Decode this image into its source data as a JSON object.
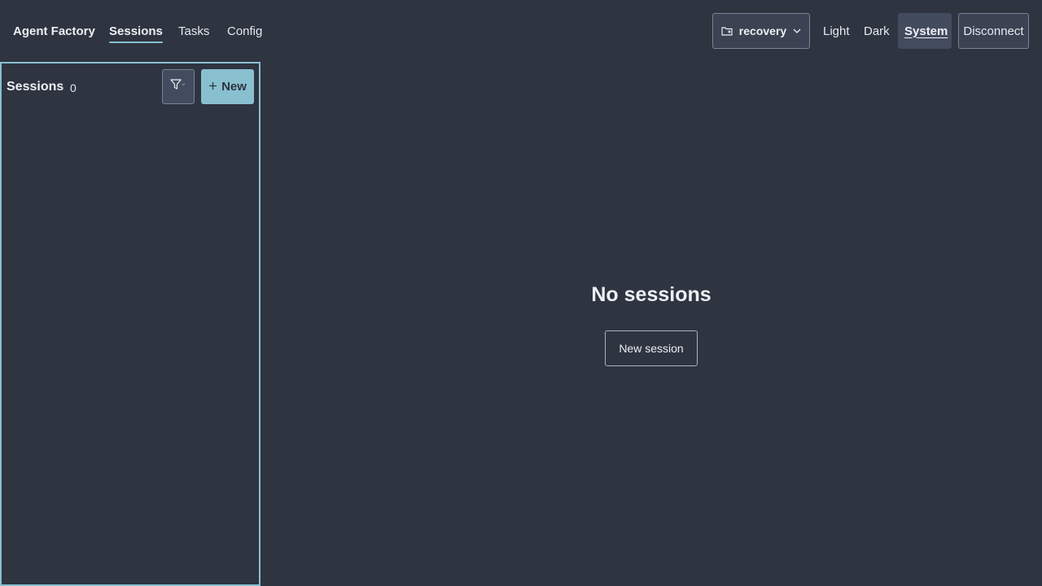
{
  "header": {
    "brand": "Agent Factory",
    "nav": [
      {
        "label": "Sessions",
        "active": true
      },
      {
        "label": "Tasks",
        "active": false
      },
      {
        "label": "Config",
        "active": false
      }
    ],
    "workspace": {
      "label": "recovery",
      "icon": "folder-icon"
    },
    "themes": [
      {
        "label": "Light",
        "active": false
      },
      {
        "label": "Dark",
        "active": false
      },
      {
        "label": "System",
        "active": true
      }
    ],
    "disconnect_label": "Disconnect"
  },
  "sidebar": {
    "title": "Sessions",
    "count": "0",
    "filter_icon": "filter-icon",
    "new_label": "New"
  },
  "main": {
    "empty_title": "No sessions",
    "new_session_label": "New session"
  },
  "colors": {
    "background": "#2e3440",
    "accent": "#88c0d0",
    "text": "#eceff4"
  }
}
